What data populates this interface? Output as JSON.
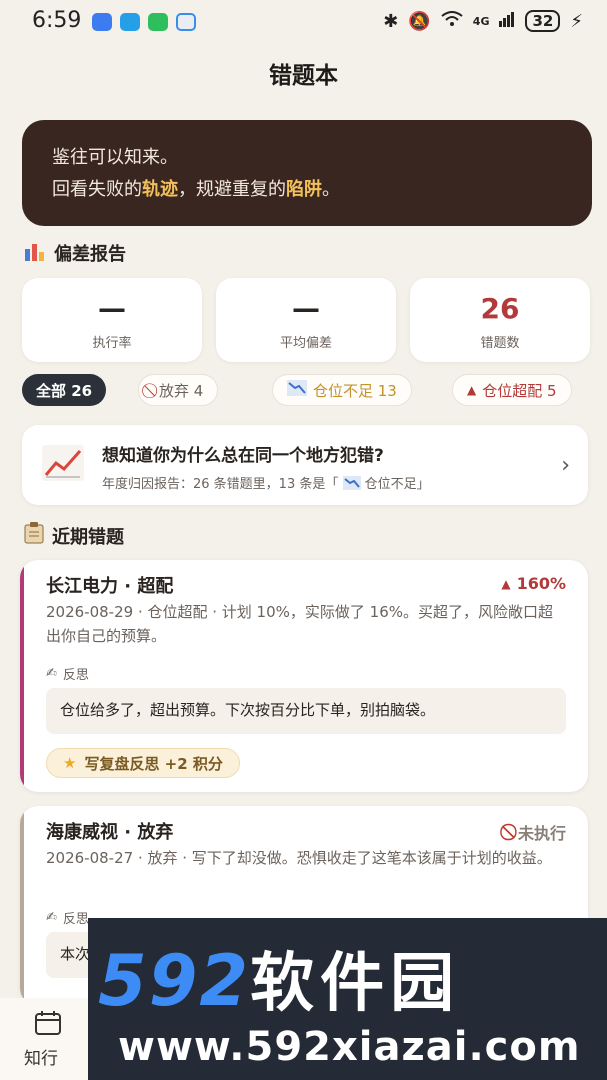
{
  "status_bar": {
    "time": "6:59",
    "signal_label": "4G",
    "battery": "32"
  },
  "page": {
    "title": "错题本"
  },
  "banner": {
    "line1": "鉴往可以知来。",
    "line2_a": "回看失败的",
    "line2_b": "轨迹",
    "line2_c": "，规避重复的",
    "line2_d": "陷阱",
    "line2_e": "。"
  },
  "deviation_report": {
    "title": "偏差报告",
    "stats": [
      {
        "value": "—",
        "label": "执行率"
      },
      {
        "value": "—",
        "label": "平均偏差"
      },
      {
        "value": "26",
        "label": "错题数"
      }
    ]
  },
  "filters": [
    {
      "label": "全部 26",
      "icon": ""
    },
    {
      "label": "放弃 4",
      "icon": "prohibited-icon"
    },
    {
      "label": "仓位不足 13",
      "icon": "down-chart-icon"
    },
    {
      "label": "仓位超配 5",
      "icon": "up-triangle-icon"
    }
  ],
  "report_card": {
    "title": "想知道你为什么总在同一个地方犯错?",
    "subtitle": "年度归因报告：26 条错题里，13 条是「",
    "subtitle_tag": "仓位不足」"
  },
  "recent": {
    "title": "近期错题",
    "items": [
      {
        "title": "长江电力 · 超配",
        "badge": "160%",
        "badge_color": "#b23a3a",
        "desc": "2026-08-29 · 仓位超配 · 计划 10%，实际做了 16%。买超了，风险敞口超出你自己的预算。",
        "reflect_label": "反思",
        "reflect_text": "仓位给多了，超出预算。下次按百分比下单，别拍脑袋。",
        "action": "写复盘反思 +2 积分",
        "accent_color": "#b23a78"
      },
      {
        "title": "海康威视 · 放弃",
        "badge": "未执行",
        "badge_color": "#8a7f77",
        "desc": "2026-08-27 · 放弃 · 写下了却没做。恐惧收走了这笔本该属于计划的收益。",
        "reflect_label": "反思",
        "reflect_text": "本次",
        "accent_color": "#b8a898"
      }
    ]
  },
  "tabbar": {
    "tab1": "知行"
  },
  "watermark": {
    "big_a": "592",
    "big_b": "软件园",
    "small": "www.592xiazai.com"
  }
}
